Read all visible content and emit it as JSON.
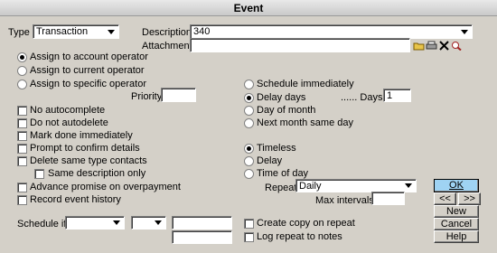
{
  "title": "Event",
  "type": {
    "label": "Type",
    "value": "Transaction"
  },
  "description": {
    "label": "Description",
    "value": "340"
  },
  "attachment": {
    "label": "Attachment",
    "value": ""
  },
  "assign_options": [
    {
      "label": "Assign to account operator",
      "selected": true
    },
    {
      "label": "Assign to current operator",
      "selected": false
    },
    {
      "label": "Assign to specific operator",
      "selected": false
    }
  ],
  "priority": {
    "label": "Priority",
    "value": ""
  },
  "checkboxes": {
    "no_autocomplete": "No autocomplete",
    "do_not_autodelete": "Do not autodelete",
    "mark_done": "Mark done immediately",
    "prompt_confirm": "Prompt to confirm details",
    "delete_same_type": "Delete same type contacts",
    "same_description": "Same description only",
    "advance_promise": "Advance promise on overpayment",
    "record_history": "Record event history",
    "create_copy": "Create copy on repeat",
    "log_repeat": "Log repeat to notes"
  },
  "schedule_options": [
    {
      "label": "Schedule immediately",
      "selected": false
    },
    {
      "label": "Delay days",
      "selected": true
    },
    {
      "label": "Day of month",
      "selected": false
    },
    {
      "label": "Next month same day",
      "selected": false
    }
  ],
  "days": {
    "label": "...... Days",
    "value": "1"
  },
  "time_options": [
    {
      "label": "Timeless",
      "selected": true
    },
    {
      "label": "Delay",
      "selected": false
    },
    {
      "label": "Time of day",
      "selected": false
    }
  ],
  "repeat": {
    "label": "Repeat",
    "value": "Daily"
  },
  "max_intervals": {
    "label": "Max intervals",
    "value": ""
  },
  "schedule_if": {
    "label": "Schedule if",
    "value1": "",
    "value2": "",
    "value3": "",
    "value4": ""
  },
  "buttons": {
    "ok": "OK",
    "prev": "<<",
    "next": ">>",
    "new": "New",
    "cancel": "Cancel",
    "help": "Help"
  }
}
